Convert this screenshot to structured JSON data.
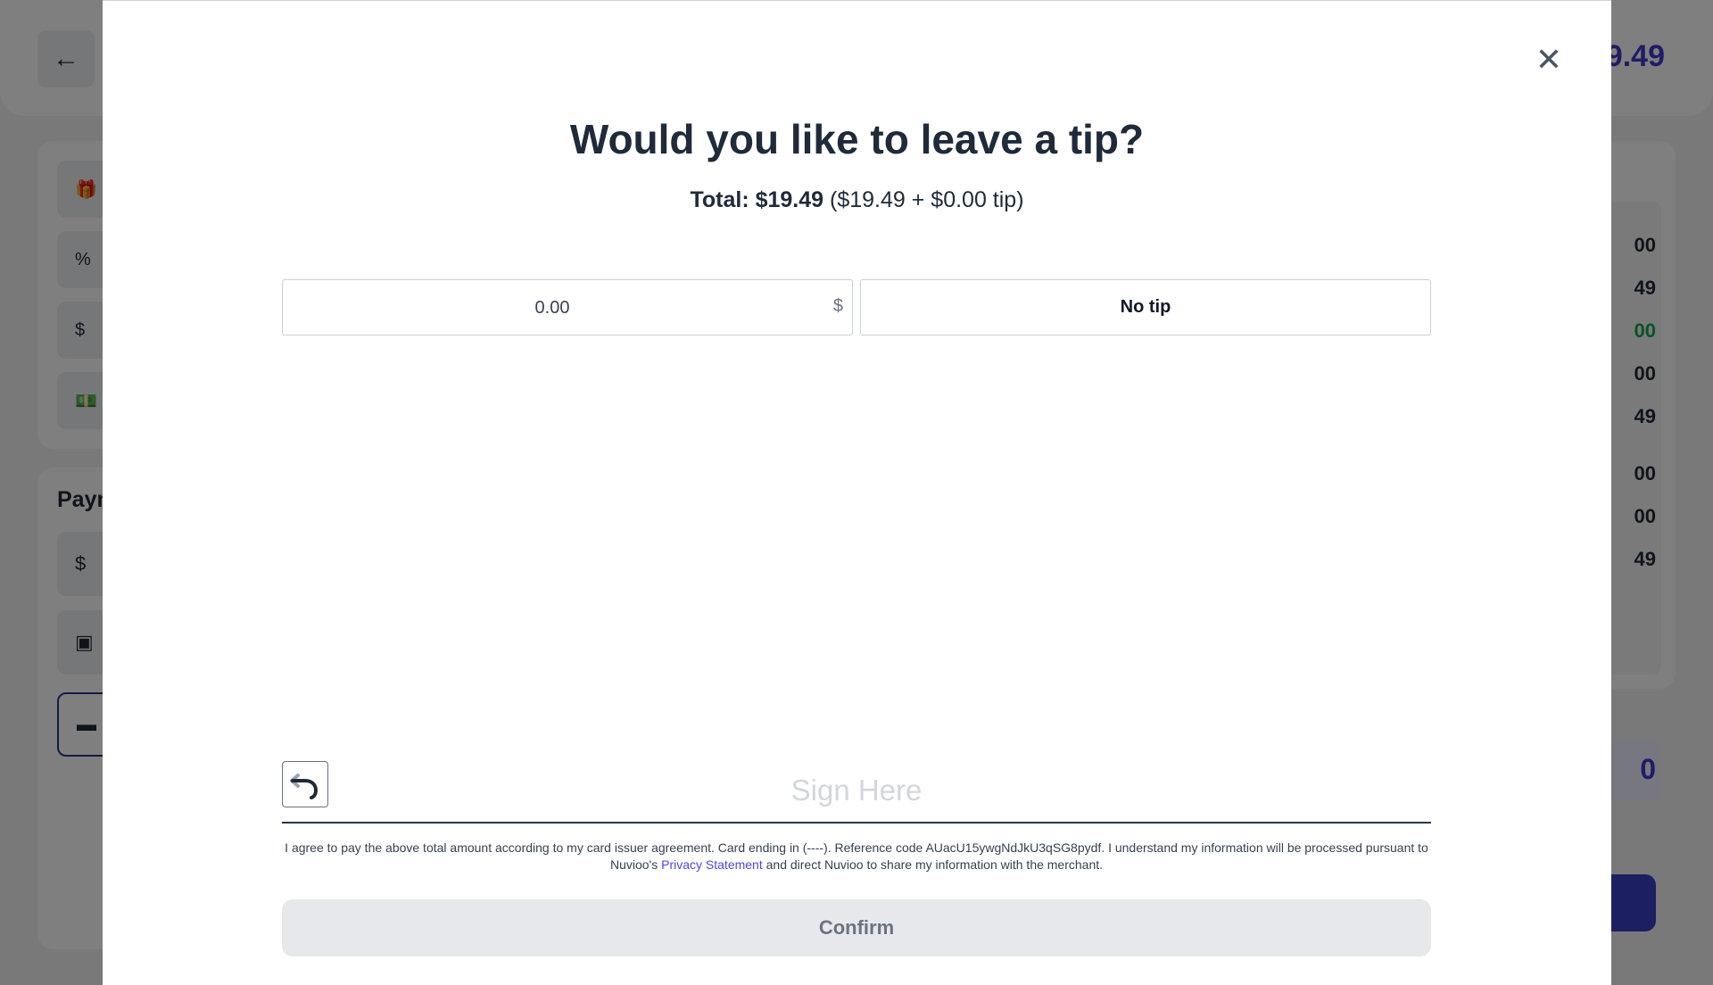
{
  "background": {
    "header_total": "9.49",
    "payment_title": "Paym",
    "summary_values": [
      "00",
      "49",
      "00",
      "00",
      "49",
      "00",
      "00",
      "49"
    ],
    "summary_highlight": "0"
  },
  "modal": {
    "title": "Would you like to leave a tip?",
    "total_label": "Total: $19.49",
    "total_breakdown": "($19.49 + $0.00 tip)",
    "tip_input": {
      "value": "0.00",
      "currency": "$"
    },
    "no_tip_label": "No tip",
    "sign_here": "Sign Here",
    "agreement_text_1": "I agree to pay the above total amount according to my card issuer agreement. Card ending in (----). Reference code AUacU15ywgNdJkU3qSG8pydf. I understand my information will be processed pursuant to Nuvioo's ",
    "privacy_link": "Privacy Statement",
    "agreement_text_2": " and direct Nuvioo to share my information with the merchant.",
    "confirm_label": "Confirm"
  },
  "colors": {
    "accent": "#4338ca",
    "link": "#4f46e5",
    "title_text": "#1f2a3a",
    "confirm_disabled_bg": "#e6e8eb",
    "positive": "#16a34a"
  },
  "icons": [
    "arrow-left-icon",
    "close-icon",
    "undo-icon",
    "gift-card-icon",
    "discount-icon",
    "coins-icon",
    "cash-icon",
    "hand-dollar-icon",
    "terminal-icon",
    "card-icon"
  ]
}
